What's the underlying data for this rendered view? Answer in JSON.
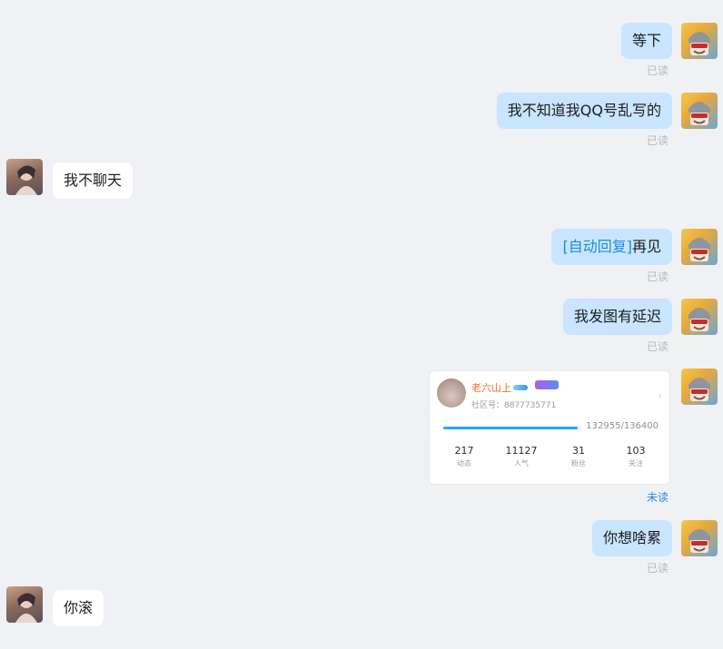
{
  "messages": [
    {
      "side": "me",
      "text": "等下",
      "status": "已读"
    },
    {
      "side": "me",
      "text": "我不知道我QQ号乱写的",
      "status": "已读"
    },
    {
      "side": "peer",
      "text": "我不聊天"
    },
    {
      "side": "me",
      "prefix": "[自动回复]",
      "text": "再见",
      "status": "已读"
    },
    {
      "side": "me",
      "text": "我发图有延迟",
      "status": "已读"
    },
    {
      "side": "me",
      "type": "profile-card",
      "status": "未读",
      "card": {
        "name": "老六山上",
        "id_text": "社区号：8877735771",
        "progress_text": "132955/136400",
        "progress_fraction": 0.975,
        "stats": [
          {
            "value": "217",
            "label": "动态"
          },
          {
            "value": "11127",
            "label": "人气"
          },
          {
            "value": "31",
            "label": "粉丝"
          },
          {
            "value": "103",
            "label": "关注"
          }
        ]
      }
    },
    {
      "side": "me",
      "text": "你想啥累",
      "status": "已读"
    },
    {
      "side": "peer",
      "text": "你滚"
    }
  ],
  "colors": {
    "background": "#f0f1f5",
    "my_bubble": "#c9e5ff",
    "peer_bubble": "#ffffff",
    "auto_reply": "#1c8dd6",
    "read_status": "#b8b9be",
    "unread_status": "#2a8bd6"
  }
}
